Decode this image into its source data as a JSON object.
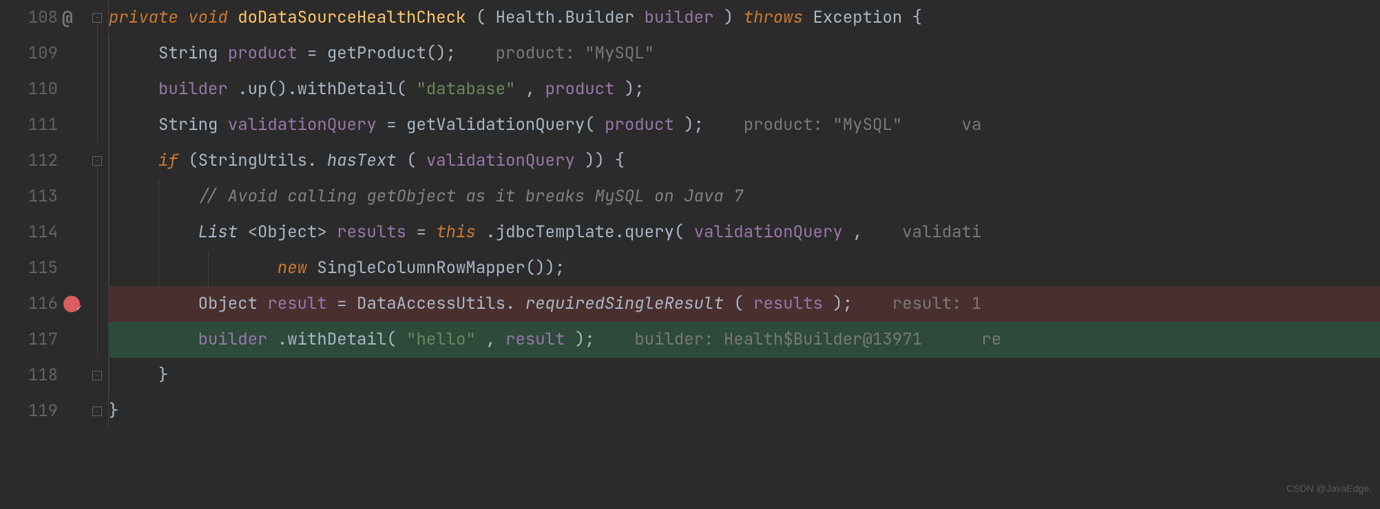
{
  "watermark": "CSDN @JavaEdge.",
  "lines": [
    {
      "num": "108"
    },
    {
      "num": "109"
    },
    {
      "num": "110"
    },
    {
      "num": "111"
    },
    {
      "num": "112"
    },
    {
      "num": "113"
    },
    {
      "num": "114"
    },
    {
      "num": "115"
    },
    {
      "num": "116"
    },
    {
      "num": "117"
    },
    {
      "num": "118"
    },
    {
      "num": "119"
    }
  ],
  "code": {
    "l108": {
      "private": "private",
      "void": "void",
      "method": "doDataSourceHealthCheck",
      "p1type": "Health.Builder",
      "p1name": "builder",
      "throws": "throws",
      "exc": "Exception",
      "brace": " {"
    },
    "l109": {
      "type": "String",
      "var": "product",
      "eq": " = ",
      "call": "getProduct();",
      "hint_label": "product: ",
      "hint_val": "\"MySQL\""
    },
    "l110": {
      "var": "builder",
      "c1": ".up().withDetail(",
      "str": "\"database\"",
      "c2": ", ",
      "arg": "product",
      "c3": ");"
    },
    "l111": {
      "type": "String",
      "var": "validationQuery",
      "eq": " = ",
      "call": "getValidationQuery(",
      "arg": "product",
      "c1": ");",
      "hint_label": "product: ",
      "hint_val": "\"MySQL\"",
      "hint2": "va"
    },
    "l112": {
      "if": "if",
      "c1": " (StringUtils.",
      "m": "hasText",
      "c2": "(",
      "arg": "validationQuery",
      "c3": ")) {"
    },
    "l113": {
      "comment": "// Avoid calling getObject as it breaks MySQL on Java 7"
    },
    "l114": {
      "type": "List",
      "gen": "<Object>",
      "var": "results",
      "eq": " = ",
      "this": "this",
      "c1": ".jdbcTemplate.query(",
      "arg": "validationQuery",
      "c2": ",",
      "hint": "validati"
    },
    "l115": {
      "new": "new",
      "c1": " SingleColumnRowMapper());"
    },
    "l116": {
      "type": "Object",
      "var": "result",
      "eq": " = ",
      "c1": "DataAccessUtils.",
      "m": "requiredSingleResult",
      "c2": "(",
      "arg": "results",
      "c3": ");",
      "hint_label": "result: ",
      "hint_val": "1"
    },
    "l117": {
      "var": "builder",
      "c1": ".withDetail(",
      "str": "\"hello\"",
      "c2": ", ",
      "arg": "result",
      "c3": ");",
      "hint_label": "builder: ",
      "hint_val": "Health$Builder@13971",
      "hint2": "re"
    },
    "l118": {
      "brace": "}"
    },
    "l119": {
      "brace": "}"
    }
  }
}
